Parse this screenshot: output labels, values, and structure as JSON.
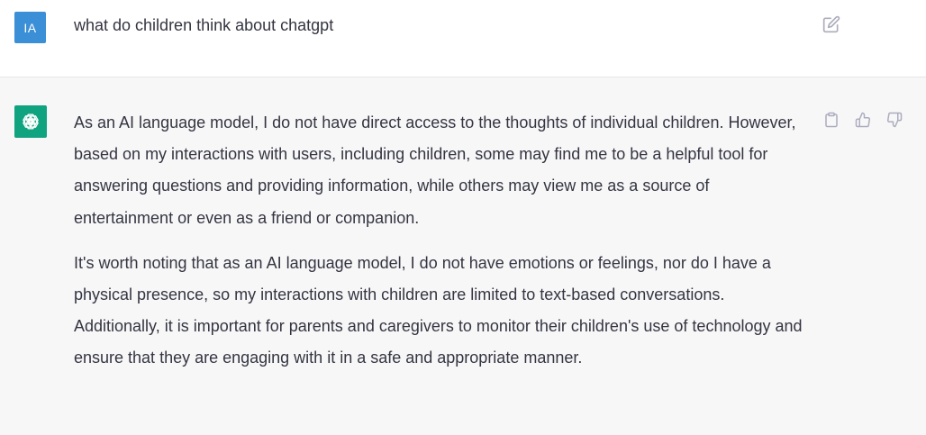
{
  "user_message": {
    "avatar_initials": "IA",
    "avatar_color": "#3b8fd6",
    "text": "what do children think about chatgpt",
    "edit_icon": "edit-icon"
  },
  "assistant_message": {
    "avatar_icon": "openai-logo-icon",
    "avatar_color": "#10a37f",
    "paragraphs": [
      "As an AI language model, I do not have direct access to the thoughts of individual children. However, based on my interactions with users, including children, some may find me to be a helpful tool for answering questions and providing information, while others may view me as a source of entertainment or even as a friend or companion.",
      "It's worth noting that as an AI language model, I do not have emotions or feelings, nor do I have a physical presence, so my interactions with children are limited to text-based conversations. Additionally, it is important for parents and caregivers to monitor their children's use of technology and ensure that they are engaging with it in a safe and appropriate manner."
    ],
    "actions": [
      "copy-icon",
      "thumbs-up-icon",
      "thumbs-down-icon"
    ]
  },
  "colors": {
    "assistant_background": "#f7f7f8",
    "text": "#343541",
    "icon": "#acacbe"
  }
}
